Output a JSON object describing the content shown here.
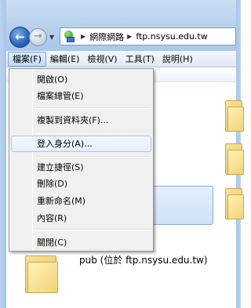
{
  "address": {
    "crumbs": [
      "網際網路",
      "ftp.nsysu.edu.tw"
    ]
  },
  "menubar": {
    "items": [
      "檔案(F)",
      "編輯(E)",
      "檢視(V)",
      "工具(T)",
      "說明(H)"
    ]
  },
  "file_menu": {
    "items": [
      "開啟(O)",
      "檔案總管(E)",
      "複製到資料夾(F)...",
      "登入身分(A)...",
      "建立捷徑(S)",
      "刪除(D)",
      "重新命名(M)",
      "內容(R)",
      "關閉(C)"
    ],
    "highlighted": "登入身分(A)..."
  },
  "content": {
    "folder_caption": "pub (位於 ftp.nsysu.edu.tw)"
  },
  "colors": {
    "menu_highlight_border": "#a8c8ec",
    "address_border": "#7b9ebd"
  }
}
